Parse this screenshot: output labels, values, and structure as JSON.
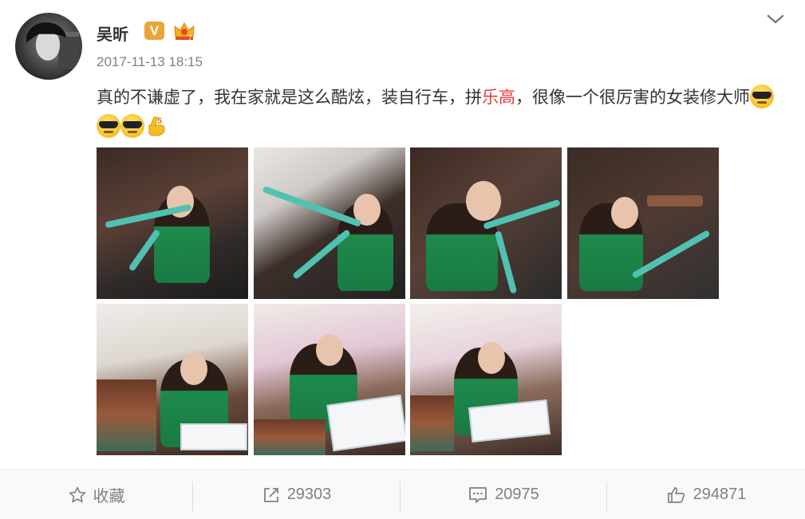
{
  "post": {
    "author": "吴昕",
    "verified_badge": "V",
    "timestamp": "2017-11-13 18:15",
    "text_before": "真的不谦虚了，我在家就是这么酷炫，装自行车，拼",
    "text_link": "乐高",
    "text_after": "，很像一个很厉害的女装修大师",
    "emojis": [
      "cool-sunglasses-emoji",
      "cool-sunglasses-emoji",
      "cool-sunglasses-emoji",
      "five-hand-emoji"
    ],
    "photos": [
      {
        "subject": "woman with teal bicycle"
      },
      {
        "subject": "woman leaning on bicycle handlebar"
      },
      {
        "subject": "woman making peace sign by bicycle"
      },
      {
        "subject": "woman assembling bicycle rear"
      },
      {
        "subject": "woman building lego set"
      },
      {
        "subject": "woman reading lego instructions"
      },
      {
        "subject": "woman with lego booklet"
      }
    ]
  },
  "actions": {
    "favorite_label": "收藏",
    "repost_count": "29303",
    "comment_count": "20975",
    "like_count": "294871"
  },
  "colors": {
    "link": "#eb3b3b",
    "badge": "#e8a53b",
    "muted": "#808080"
  }
}
